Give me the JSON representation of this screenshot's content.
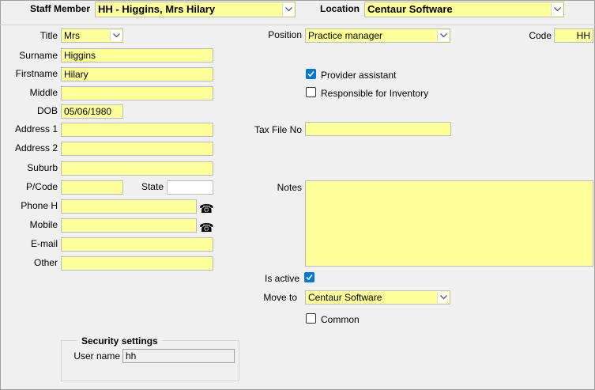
{
  "header": {
    "staff_member_label": "Staff Member",
    "staff_member_value": "HH - Higgins, Mrs Hilary",
    "location_label": "Location",
    "location_value": "Centaur Software"
  },
  "personal": {
    "title_label": "Title",
    "title_value": "Mrs",
    "surname_label": "Surname",
    "surname_value": "Higgins",
    "firstname_label": "Firstname",
    "firstname_value": "Hilary",
    "middle_label": "Middle",
    "middle_value": "",
    "dob_label": "DOB",
    "dob_value": "05/06/1980",
    "address1_label": "Address 1",
    "address1_value": "",
    "address2_label": "Address 2",
    "address2_value": "",
    "suburb_label": "Suburb",
    "suburb_value": "",
    "postcode_label": "P/Code",
    "postcode_value": "",
    "state_label": "State",
    "state_value": "",
    "phone_h_label": "Phone H",
    "phone_h_value": "",
    "mobile_label": "Mobile",
    "mobile_value": "",
    "email_label": "E-mail",
    "email_value": "",
    "other_label": "Other",
    "other_value": ""
  },
  "work": {
    "position_label": "Position",
    "position_value": "Practice manager",
    "code_label": "Code",
    "code_value": "HH",
    "provider_assistant_label": "Provider assistant",
    "provider_assistant_checked": true,
    "responsible_inventory_label": "Responsible for Inventory",
    "responsible_inventory_checked": false,
    "tax_file_label": "Tax File No",
    "tax_file_value": "",
    "notes_label": "Notes",
    "notes_value": "",
    "is_active_label": "Is active",
    "is_active_checked": true,
    "move_to_label": "Move to",
    "move_to_value": "Centaur Software",
    "common_label": "Common",
    "common_checked": false
  },
  "security": {
    "title": "Security settings",
    "username_label": "User name",
    "username_value": "hh"
  },
  "icons": {
    "dropdown": "chevron-down-icon",
    "phone": "telephone-icon",
    "check": "checkmark-icon"
  },
  "colors": {
    "field_bg": "#ffff99",
    "checkbox_on": "#0078d7",
    "window_bg": "#f0f0f0"
  }
}
